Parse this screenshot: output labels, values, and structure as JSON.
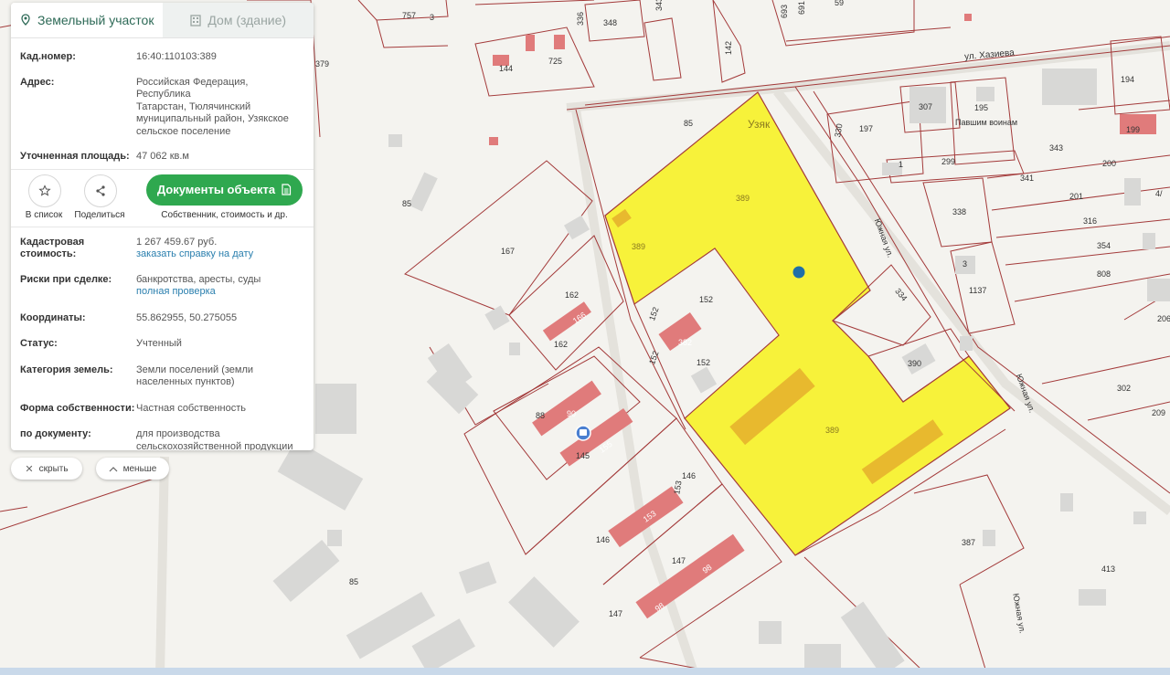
{
  "tabs": [
    {
      "label": "Земельный участок",
      "icon": "map-pin-icon"
    },
    {
      "label": "Дом (здание)",
      "icon": "building-icon"
    }
  ],
  "info": {
    "cad_label": "Кад.номер:",
    "cad_value": "16:40:110103:389",
    "address_label": "Адрес:",
    "address_lines": [
      "Российская Федерация, Республика",
      "Татарстан, Тюлячинский",
      "муниципальный район, Узякское",
      "сельское поселение"
    ],
    "area_label": "Уточненная площадь:",
    "area_value": "47 062 кв.м"
  },
  "actions": {
    "favorite_label": "В список",
    "share_label": "Поделиться",
    "documents_label": "Документы объекта",
    "documents_sub": "Собственник, стоимость и др."
  },
  "details": {
    "cost_label_1": "Кадастровая",
    "cost_label_2": "стоимость:",
    "cost_value": "1 267 459.67 руб.",
    "cost_link": "заказать справку на дату",
    "risks_label": "Риски при сделке:",
    "risks_value": "банкротства, аресты, суды",
    "risks_link": "полная проверка",
    "coords_label": "Координаты:",
    "coords_value": "55.862955, 50.275055",
    "status_label": "Статус:",
    "status_value": "Учтенный",
    "category_label": "Категория земель:",
    "category_lines": [
      "Земли поселений (земли",
      "населенных пунктов)"
    ],
    "ownership_label": "Форма собственности:",
    "ownership_value": "Частная собственность",
    "purpose_label": "по документу:",
    "purpose_lines": [
      "для производства",
      "сельскохозяйственной продукции"
    ]
  },
  "controls": {
    "hide_label": "скрыть",
    "less_label": "меньше"
  },
  "map": {
    "parcel_color": "#f7f23a",
    "boundary_color": "#a33a3a",
    "building_color": "#e07b7b",
    "marker_color": "#1f6fa8",
    "labels": [
      {
        "id": "l757",
        "text": "757"
      },
      {
        "id": "l3a",
        "text": "3"
      },
      {
        "id": "l336",
        "text": "336"
      },
      {
        "id": "l348",
        "text": "348"
      },
      {
        "id": "l343",
        "text": "343"
      },
      {
        "id": "l142",
        "text": "142"
      },
      {
        "id": "l693",
        "text": "693"
      },
      {
        "id": "l691",
        "text": "691"
      },
      {
        "id": "l59",
        "text": "59"
      },
      {
        "id": "l725",
        "text": "725"
      },
      {
        "id": "l144",
        "text": "144"
      },
      {
        "id": "l379",
        "text": "379"
      },
      {
        "id": "l85a",
        "text": "85"
      },
      {
        "id": "luzyak",
        "text": "Узяк"
      },
      {
        "id": "l389a",
        "text": "389"
      },
      {
        "id": "l389b",
        "text": "389"
      },
      {
        "id": "l389c",
        "text": "389"
      },
      {
        "id": "l85b",
        "text": "85"
      },
      {
        "id": "l167",
        "text": "167"
      },
      {
        "id": "l162a",
        "text": "162"
      },
      {
        "id": "l166",
        "text": "166"
      },
      {
        "id": "l162b",
        "text": "162"
      },
      {
        "id": "l152a",
        "text": "152"
      },
      {
        "id": "l152b",
        "text": "152"
      },
      {
        "id": "l152c",
        "text": "152"
      },
      {
        "id": "l152d",
        "text": "152"
      },
      {
        "id": "l382",
        "text": "382"
      },
      {
        "id": "l88",
        "text": "88"
      },
      {
        "id": "l90",
        "text": "90"
      },
      {
        "id": "l145",
        "text": "145"
      },
      {
        "id": "l155",
        "text": "155"
      },
      {
        "id": "l153a",
        "text": "153"
      },
      {
        "id": "l153b",
        "text": "153"
      },
      {
        "id": "l146a",
        "text": "146"
      },
      {
        "id": "l146b",
        "text": "146"
      },
      {
        "id": "l147a",
        "text": "147"
      },
      {
        "id": "l147b",
        "text": "147"
      },
      {
        "id": "l98a",
        "text": "98"
      },
      {
        "id": "l98b",
        "text": "98"
      },
      {
        "id": "l85c",
        "text": "85"
      },
      {
        "id": "l390",
        "text": "390"
      },
      {
        "id": "l334",
        "text": "334"
      },
      {
        "id": "l387",
        "text": "387"
      },
      {
        "id": "l413",
        "text": "413"
      },
      {
        "id": "lhaz",
        "text": "ул. Хазиева"
      },
      {
        "id": "l307",
        "text": "307"
      },
      {
        "id": "l195",
        "text": "195"
      },
      {
        "id": "lpav",
        "text": "Павшим воинам"
      },
      {
        "id": "l197",
        "text": "197"
      },
      {
        "id": "l330",
        "text": "330"
      },
      {
        "id": "l299",
        "text": "299"
      },
      {
        "id": "l1",
        "text": "1"
      },
      {
        "id": "l341",
        "text": "341"
      },
      {
        "id": "l343b",
        "text": "343"
      },
      {
        "id": "l200",
        "text": "200"
      },
      {
        "id": "l201",
        "text": "201"
      },
      {
        "id": "l194",
        "text": "194"
      },
      {
        "id": "l199",
        "text": "199"
      },
      {
        "id": "l338",
        "text": "338"
      },
      {
        "id": "l316",
        "text": "316"
      },
      {
        "id": "l354",
        "text": "354"
      },
      {
        "id": "l808",
        "text": "808"
      },
      {
        "id": "l1137",
        "text": "1137"
      },
      {
        "id": "l3b",
        "text": "3"
      },
      {
        "id": "l302",
        "text": "302"
      },
      {
        "id": "l209",
        "text": "209"
      },
      {
        "id": "l206",
        "text": "206"
      },
      {
        "id": "l4",
        "text": "4/"
      },
      {
        "id": "lyuzh1",
        "text": "Южная ул."
      },
      {
        "id": "lyuzh2",
        "text": "Южная ул."
      },
      {
        "id": "lyuzh3",
        "text": "Южная ул."
      }
    ]
  }
}
